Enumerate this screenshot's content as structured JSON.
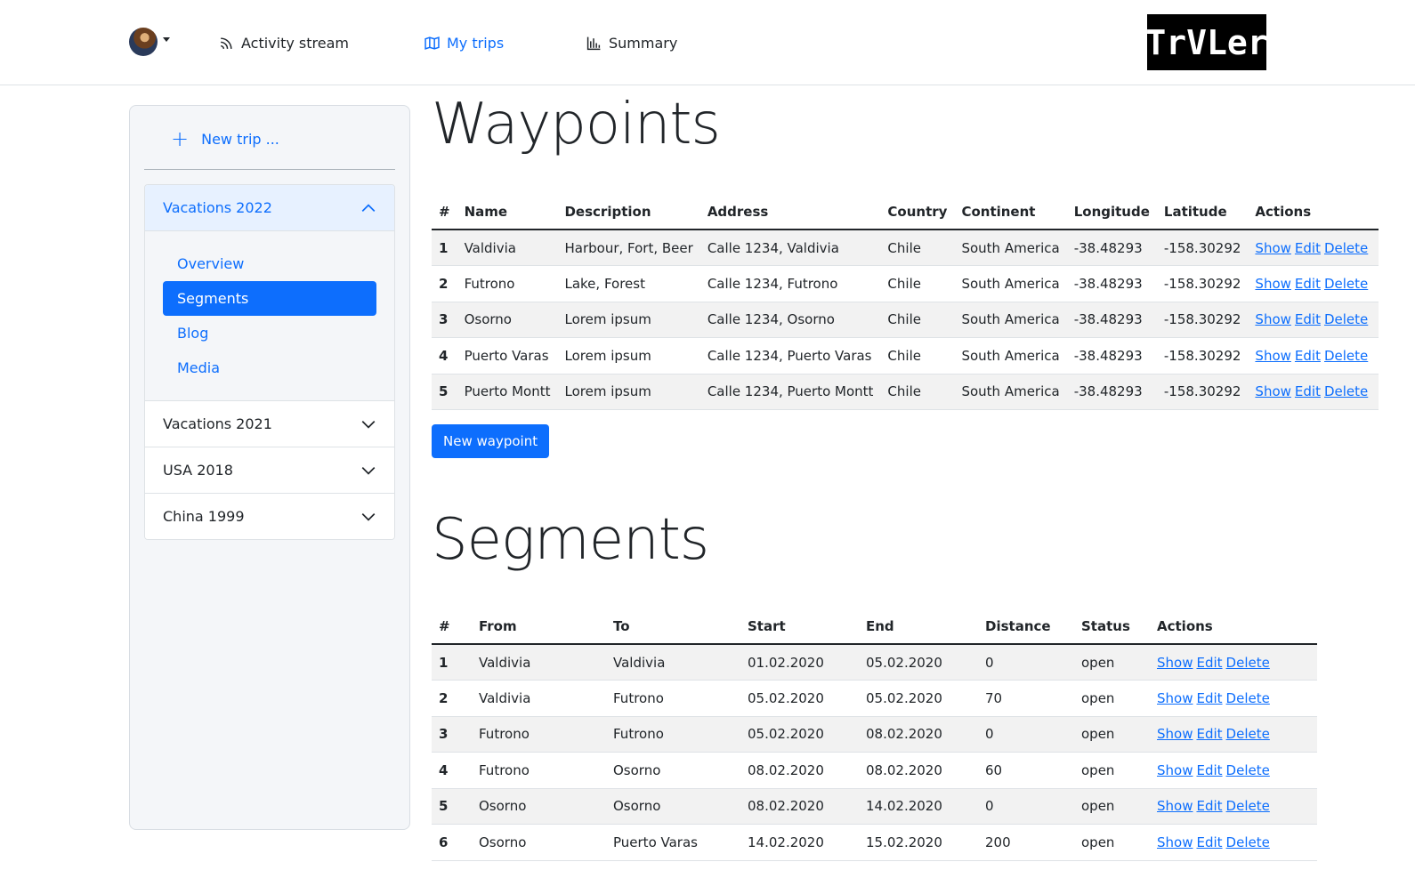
{
  "nav": {
    "links": [
      {
        "label": "Activity stream",
        "icon": "rss-icon"
      },
      {
        "label": "My trips",
        "icon": "map-icon"
      },
      {
        "label": "Summary",
        "icon": "bar-chart-icon"
      }
    ],
    "logo_text": "TrVLer"
  },
  "sidebar": {
    "new_trip": "New trip ...",
    "trips": [
      {
        "label": "Vacations 2022",
        "open": true,
        "items": [
          "Overview",
          "Segments",
          "Blog",
          "Media"
        ],
        "active_item": "Segments"
      },
      {
        "label": "Vacations 2021",
        "open": false
      },
      {
        "label": "USA 2018",
        "open": false
      },
      {
        "label": "China 1999",
        "open": false
      }
    ]
  },
  "waypoints": {
    "title": "Waypoints",
    "headers": [
      "#",
      "Name",
      "Description",
      "Address",
      "Country",
      "Continent",
      "Longitude",
      "Latitude",
      "Actions"
    ],
    "rows": [
      [
        "1",
        "Valdivia",
        "Harbour, Fort, Beer",
        "Calle 1234, Valdivia",
        "Chile",
        "South America",
        "-38.48293",
        "-158.30292"
      ],
      [
        "2",
        "Futrono",
        "Lake, Forest",
        "Calle 1234, Futrono",
        "Chile",
        "South America",
        "-38.48293",
        "-158.30292"
      ],
      [
        "3",
        "Osorno",
        "Lorem ipsum",
        "Calle 1234, Osorno",
        "Chile",
        "South America",
        "-38.48293",
        "-158.30292"
      ],
      [
        "4",
        "Puerto Varas",
        "Lorem ipsum",
        "Calle 1234, Puerto Varas",
        "Chile",
        "South America",
        "-38.48293",
        "-158.30292"
      ],
      [
        "5",
        "Puerto Montt",
        "Lorem ipsum",
        "Calle 1234, Puerto Montt",
        "Chile",
        "South America",
        "-38.48293",
        "-158.30292"
      ]
    ],
    "actions": [
      "Show",
      "Edit",
      "Delete"
    ],
    "new_button": "New waypoint"
  },
  "segments": {
    "title": "Segments",
    "headers": [
      "#",
      "From",
      "To",
      "Start",
      "End",
      "Distance",
      "Status",
      "Actions"
    ],
    "rows": [
      [
        "1",
        "Valdivia",
        "Valdivia",
        "01.02.2020",
        "05.02.2020",
        "0",
        "open"
      ],
      [
        "2",
        "Valdivia",
        "Futrono",
        "05.02.2020",
        "05.02.2020",
        "70",
        "open"
      ],
      [
        "3",
        "Futrono",
        "Futrono",
        "05.02.2020",
        "08.02.2020",
        "0",
        "open"
      ],
      [
        "4",
        "Futrono",
        "Osorno",
        "08.02.2020",
        "08.02.2020",
        "60",
        "open"
      ],
      [
        "5",
        "Osorno",
        "Osorno",
        "08.02.2020",
        "14.02.2020",
        "0",
        "open"
      ],
      [
        "6",
        "Osorno",
        "Puerto Varas",
        "14.02.2020",
        "15.02.2020",
        "200",
        "open"
      ]
    ],
    "actions": [
      "Show",
      "Edit",
      "Delete"
    ]
  },
  "colors": {
    "accent": "#0d6efd",
    "sidebar_bg": "#f4f6f9"
  }
}
